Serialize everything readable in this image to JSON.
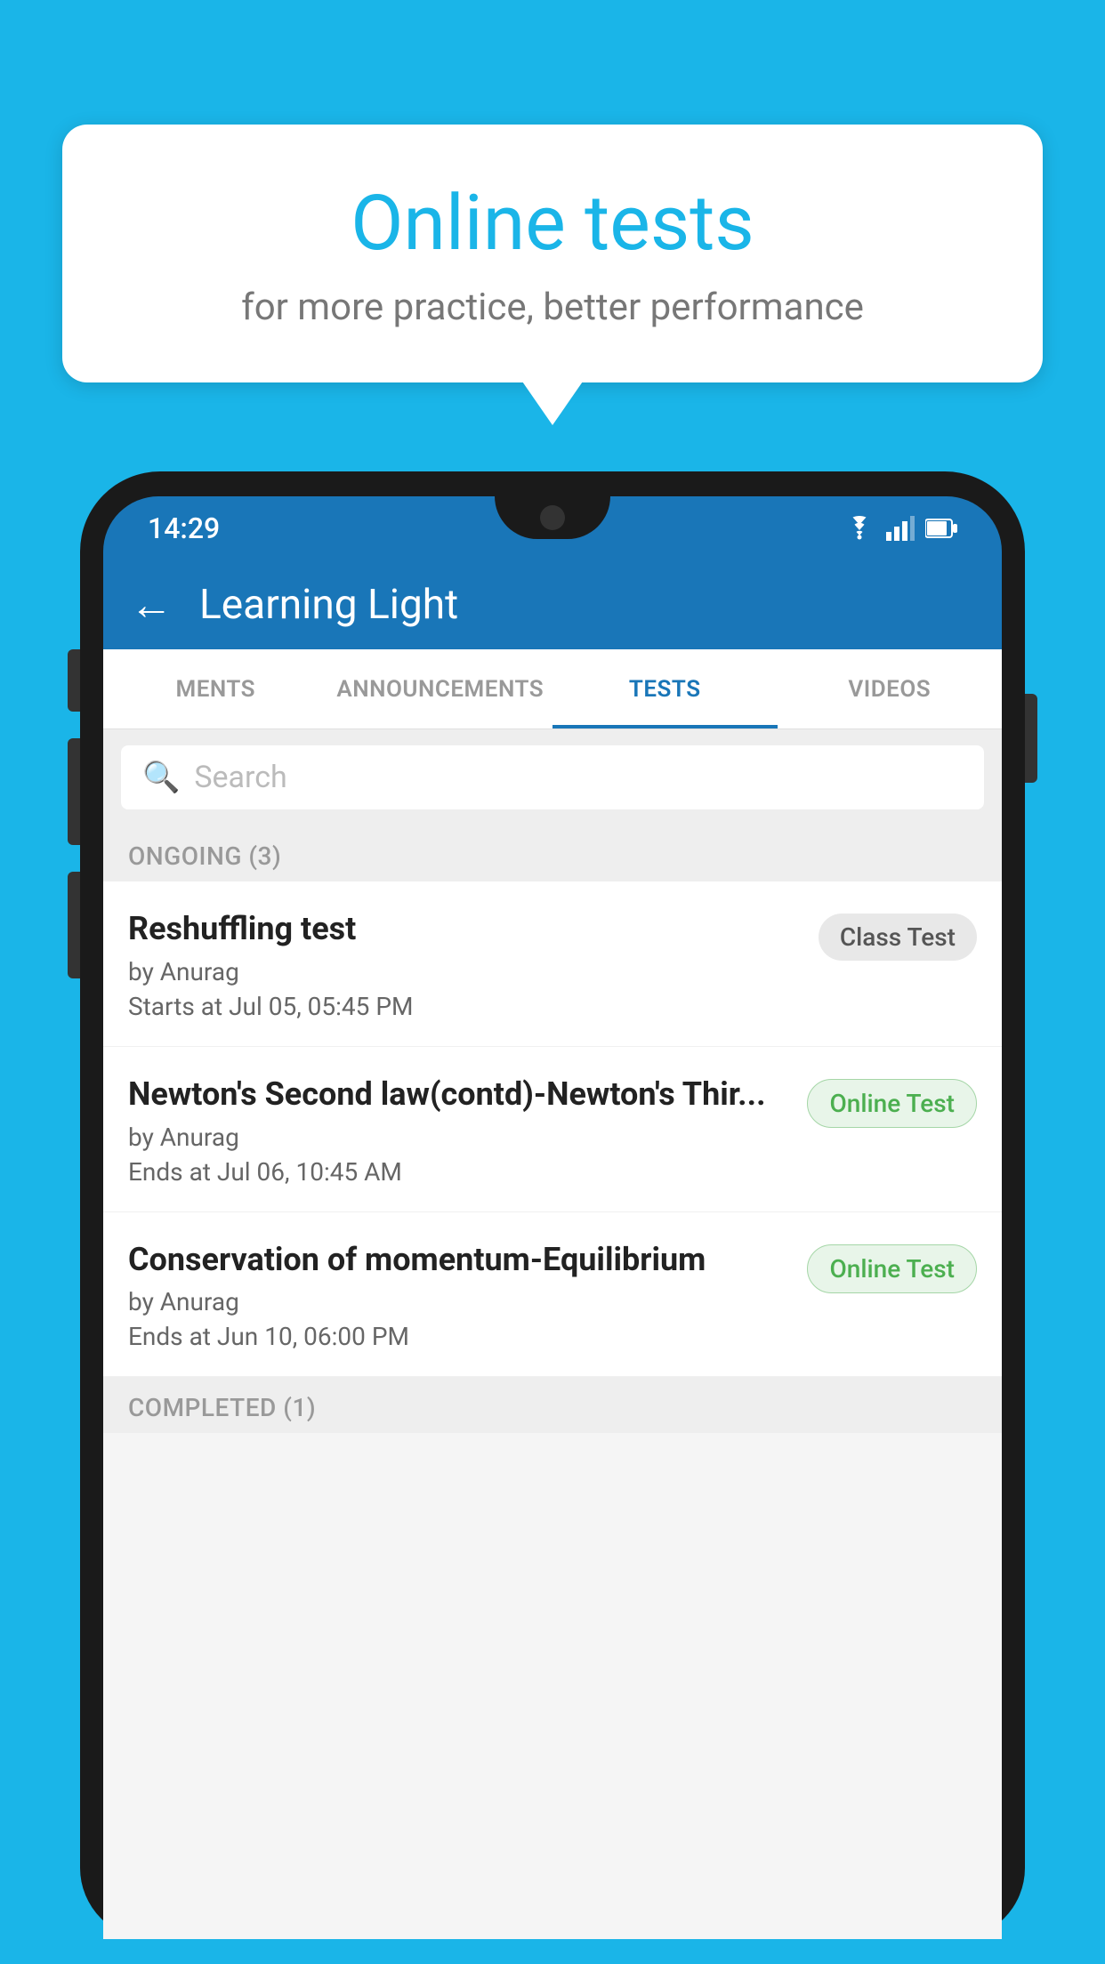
{
  "background_color": "#1ab5e8",
  "speech_bubble": {
    "title": "Online tests",
    "subtitle": "for more practice, better performance"
  },
  "phone": {
    "status_bar": {
      "time": "14:29",
      "wifi_icon": "wifi-icon",
      "signal_icon": "signal-icon",
      "battery_icon": "battery-icon"
    },
    "app_bar": {
      "back_label": "←",
      "title": "Learning Light"
    },
    "tabs": [
      {
        "label": "MENTS",
        "active": false
      },
      {
        "label": "ANNOUNCEMENTS",
        "active": false
      },
      {
        "label": "TESTS",
        "active": true
      },
      {
        "label": "VIDEOS",
        "active": false
      }
    ],
    "search": {
      "placeholder": "Search"
    },
    "ongoing_section": {
      "header": "ONGOING (3)",
      "items": [
        {
          "title": "Reshuffling test",
          "author": "by Anurag",
          "time_label": "Starts at",
          "time": "Jul 05, 05:45 PM",
          "badge": "Class Test",
          "badge_type": "class"
        },
        {
          "title": "Newton's Second law(contd)-Newton's Thir...",
          "author": "by Anurag",
          "time_label": "Ends at",
          "time": "Jul 06, 10:45 AM",
          "badge": "Online Test",
          "badge_type": "online"
        },
        {
          "title": "Conservation of momentum-Equilibrium",
          "author": "by Anurag",
          "time_label": "Ends at",
          "time": "Jun 10, 06:00 PM",
          "badge": "Online Test",
          "badge_type": "online"
        }
      ]
    },
    "completed_section": {
      "header": "COMPLETED (1)"
    }
  }
}
